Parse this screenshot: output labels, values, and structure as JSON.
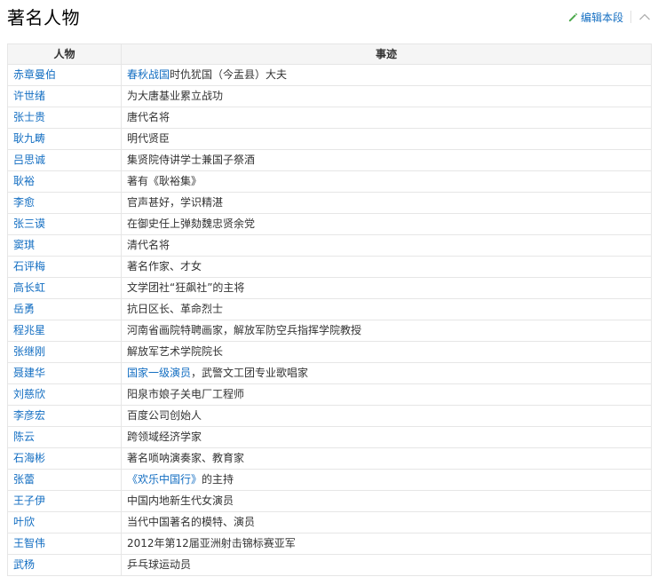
{
  "section": {
    "title": "著名人物",
    "edit_label": "编辑本段"
  },
  "table": {
    "headers": [
      "人物",
      "事迹"
    ],
    "rows": [
      {
        "name": "赤章曼伯",
        "deed_link": "春秋战国",
        "deed": "时仇犹国（今盂县）大夫"
      },
      {
        "name": "许世绪",
        "deed": "为大唐基业累立战功"
      },
      {
        "name": "张士贵",
        "deed": "唐代名将"
      },
      {
        "name": "耿九畴",
        "deed": "明代贤臣"
      },
      {
        "name": "吕思诚",
        "deed": "集贤院侍讲学士兼国子祭酒"
      },
      {
        "name": "耿裕",
        "deed": "著有《耿裕集》"
      },
      {
        "name": "李愈",
        "deed": "官声甚好，学识精湛"
      },
      {
        "name": "张三谟",
        "deed": "在御史任上弹劾魏忠贤余党"
      },
      {
        "name": "窦琪",
        "deed": "清代名将"
      },
      {
        "name": "石评梅",
        "deed": "著名作家、才女"
      },
      {
        "name": "高长虹",
        "deed": "文学团社“狂飙社”的主将"
      },
      {
        "name": "岳勇",
        "deed": "抗日区长、革命烈士"
      },
      {
        "name": "程兆星",
        "deed": "河南省画院特聘画家，解放军防空兵指挥学院教授"
      },
      {
        "name": "张继刚",
        "deed": "解放军艺术学院院长"
      },
      {
        "name": "聂建华",
        "deed_link": "国家一级演员",
        "deed": "，武警文工团专业歌唱家"
      },
      {
        "name": "刘慈欣",
        "deed": "阳泉市娘子关电厂工程师"
      },
      {
        "name": "李彦宏",
        "deed": "百度公司创始人"
      },
      {
        "name": "陈云",
        "deed": "跨领域经济学家"
      },
      {
        "name": "石海彬",
        "deed": "著名唢呐演奏家、教育家"
      },
      {
        "name": "张蕾",
        "deed_link": "《欢乐中国行》",
        "deed": "的主持"
      },
      {
        "name": "王子伊",
        "deed": "中国内地新生代女演员"
      },
      {
        "name": "叶欣",
        "deed": "当代中国著名的模特、演员"
      },
      {
        "name": "王智伟",
        "deed": "2012年第12届亚洲射击锦标赛亚军"
      },
      {
        "name": "武杨",
        "deed": "乒乓球运动员"
      }
    ]
  },
  "icons": {
    "edit": "pencil-icon",
    "collapse": "chevron-up-icon"
  },
  "colors": {
    "link": "#136ec2",
    "edit_icon": "#4aa84a",
    "header_bg": "#f5f5f5",
    "border": "#e6e6e6"
  }
}
